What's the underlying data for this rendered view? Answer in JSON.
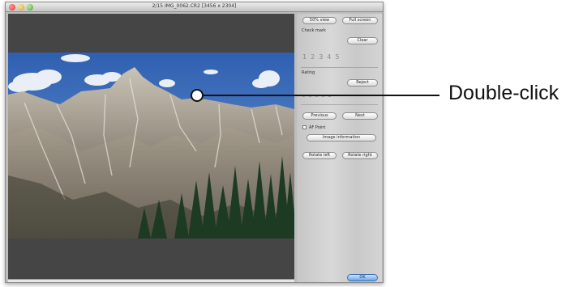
{
  "window": {
    "title": "2/15 IMG_0062.CR2 [3456 x 2304]"
  },
  "panel": {
    "view_100_label": "50% view",
    "fullscreen_label": "Full screen",
    "check_mark_label": "Check mark",
    "clear_label": "Clear",
    "check_marks": [
      "1",
      "2",
      "3",
      "4",
      "5"
    ],
    "rating_label": "Rating",
    "reject_label": "Reject",
    "previous_label": "Previous",
    "next_label": "Next",
    "af_point_label": "AF Point",
    "image_info_label": "Image information",
    "rotate_left_label": "Rotate left",
    "rotate_right_label": "Rotate right",
    "ok_label": "OK"
  },
  "callout": {
    "label": "Double-click"
  }
}
